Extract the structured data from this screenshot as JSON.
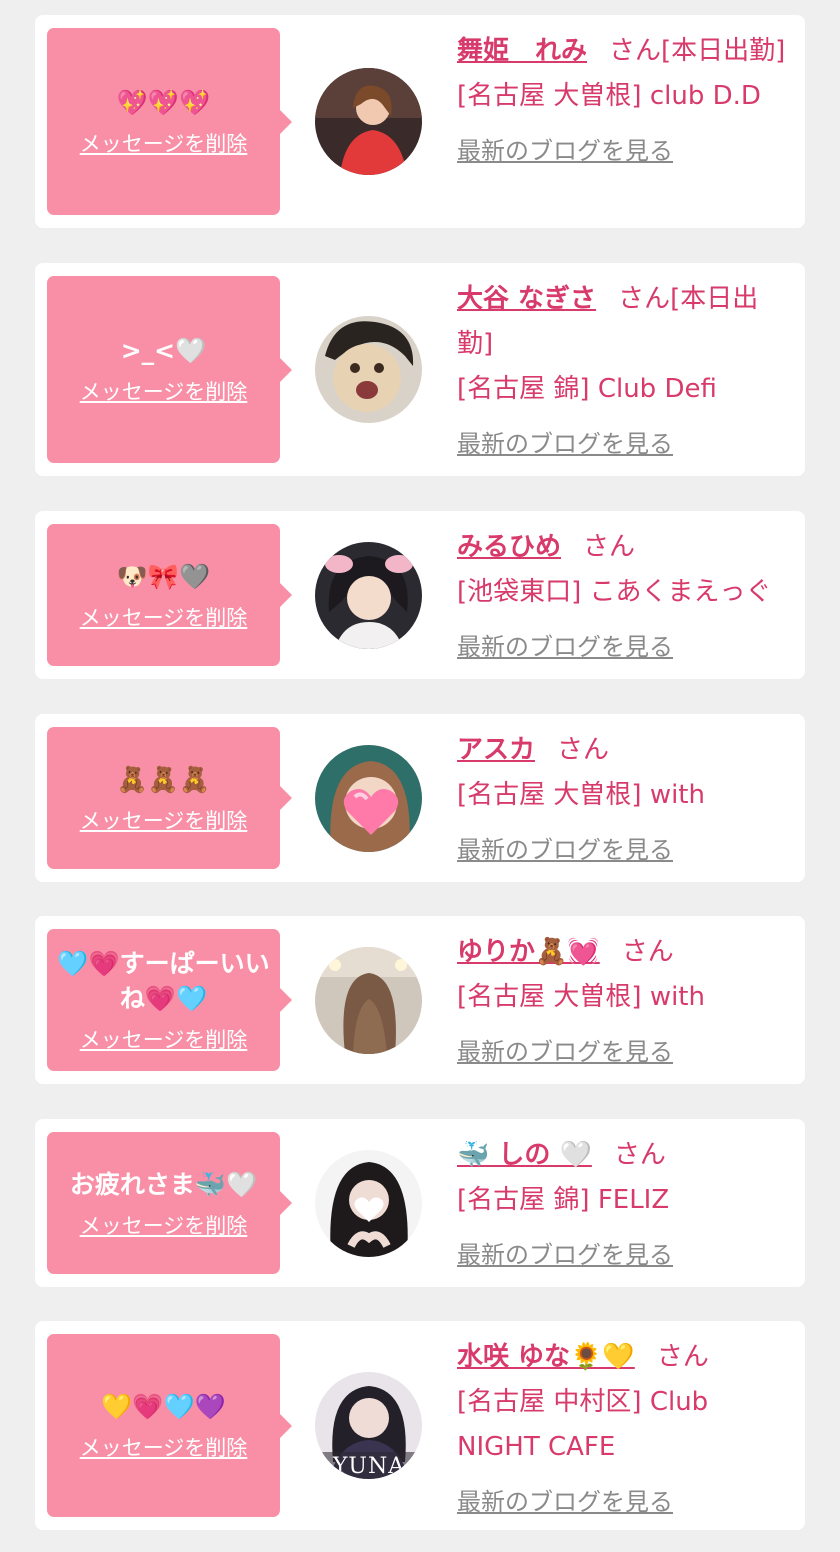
{
  "delete_label": "メッセージを削除",
  "blog_label": "最新のブログを見る",
  "san_label": "さん",
  "colors": {
    "bubble": "#f98fa6",
    "accent": "#d73a6b",
    "link_gray": "#8a8a8a",
    "background": "#efefef"
  },
  "messages": [
    {
      "message": "💖💖💖",
      "name": "舞姫　れみ",
      "status": "[本日出勤]",
      "shop": "[名古屋 大曽根] club D.D"
    },
    {
      "message": ">_<🤍",
      "name": "大谷 なぎさ",
      "status": "[本日出勤]",
      "shop": "[名古屋 錦] Club Defi"
    },
    {
      "message": "🐶🎀🩶",
      "name": "みるひめ",
      "status": "",
      "shop": "[池袋東口] こあくまえっぐ"
    },
    {
      "message": "🧸🧸🧸",
      "name": "アスカ",
      "status": "",
      "shop": "[名古屋 大曽根] with"
    },
    {
      "message": "🩵💗すーぱーいいね💗🩵",
      "name": "ゆりか🧸💓",
      "status": "",
      "shop": "[名古屋 大曽根] with"
    },
    {
      "message": "お疲れさま🐳🤍",
      "name": "🐳 しの 🤍",
      "status": "",
      "shop": "[名古屋 錦] FELIZ"
    },
    {
      "message": "💛💗🩵💜",
      "name": "水咲 ゆな🌻💛",
      "status": "",
      "shop": "[名古屋 中村区] Club NIGHT CAFE"
    }
  ]
}
